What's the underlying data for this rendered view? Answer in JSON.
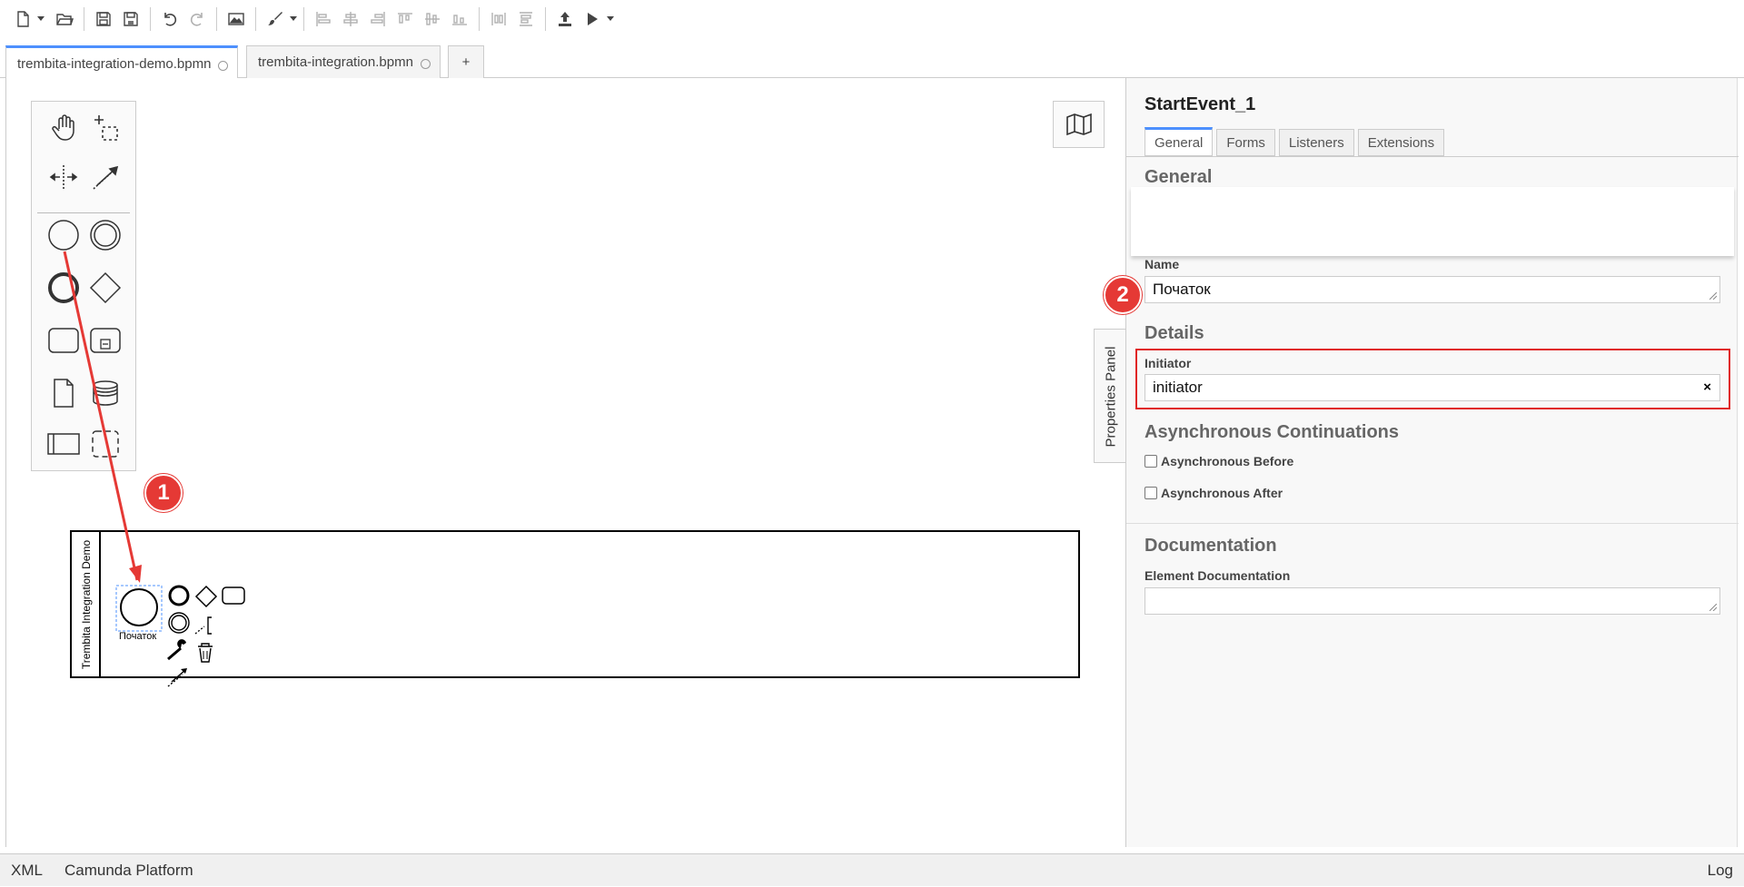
{
  "toolbar": {
    "buttons": [
      "new-file-icon",
      "open-folder-icon",
      "save-icon",
      "save-as-icon",
      "undo-icon",
      "redo-icon",
      "export-image-icon",
      "color-brush-icon",
      "align-left-icon",
      "align-center-icon",
      "align-right-icon",
      "align-top-icon",
      "align-middle-icon",
      "align-bottom-icon",
      "distribute-horizontal-icon",
      "distribute-vertical-icon",
      "deploy-icon",
      "run-icon"
    ]
  },
  "tabs": [
    {
      "label": "trembita-integration-demo.bpmn",
      "active": true
    },
    {
      "label": "trembita-integration.bpmn",
      "active": false
    },
    {
      "label": "+"
    }
  ],
  "canvas": {
    "pool_label": "Trembita Integration Demo",
    "start_event_label": "Початок",
    "badge1": "1"
  },
  "properties": {
    "toggle_label": "Properties Panel",
    "title": "StartEvent_1",
    "tabs": [
      "General",
      "Forms",
      "Listeners",
      "Extensions"
    ],
    "sections": {
      "general": "General",
      "details": "Details",
      "async": "Asynchronous Continuations",
      "documentation": "Documentation"
    },
    "fields": {
      "name_label": "Name",
      "name_value": "Початок",
      "initiator_label": "Initiator",
      "initiator_value": "initiator",
      "async_before": "Asynchronous Before",
      "async_after": "Asynchronous After",
      "doc_label": "Element Documentation",
      "clear": "×"
    },
    "badge2": "2"
  },
  "statusbar": {
    "xml": "XML",
    "platform": "Camunda Platform",
    "log": "Log"
  },
  "colors": {
    "accent": "#4d90fe",
    "annotation_red": "#e53935"
  }
}
